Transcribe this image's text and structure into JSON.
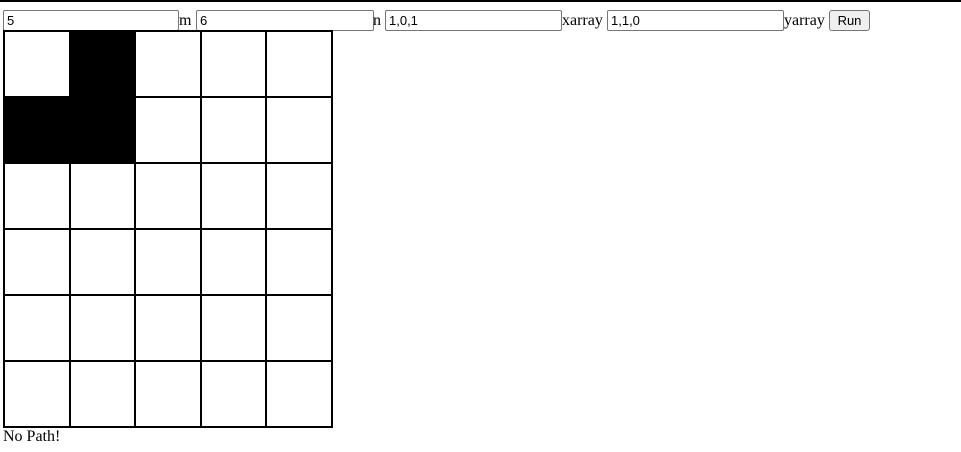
{
  "controls": {
    "m_value": "5",
    "m_label": "m",
    "n_value": "6",
    "n_label": "n",
    "xarray_value": "1,0,1",
    "xarray_label": "xarray",
    "yarray_value": "1,1,0",
    "yarray_label": "yarray",
    "run_label": "Run"
  },
  "grid": {
    "rows": [
      [
        0,
        1,
        0,
        0,
        0
      ],
      [
        1,
        1,
        0,
        0,
        0
      ],
      [
        0,
        0,
        0,
        0,
        0
      ],
      [
        0,
        0,
        0,
        0,
        0
      ],
      [
        0,
        0,
        0,
        0,
        0
      ],
      [
        0,
        0,
        0,
        0,
        0
      ]
    ]
  },
  "result": {
    "message": "No Path!"
  },
  "colors": {
    "wall": "#000000",
    "open": "#ffffff",
    "line": "#000000"
  }
}
